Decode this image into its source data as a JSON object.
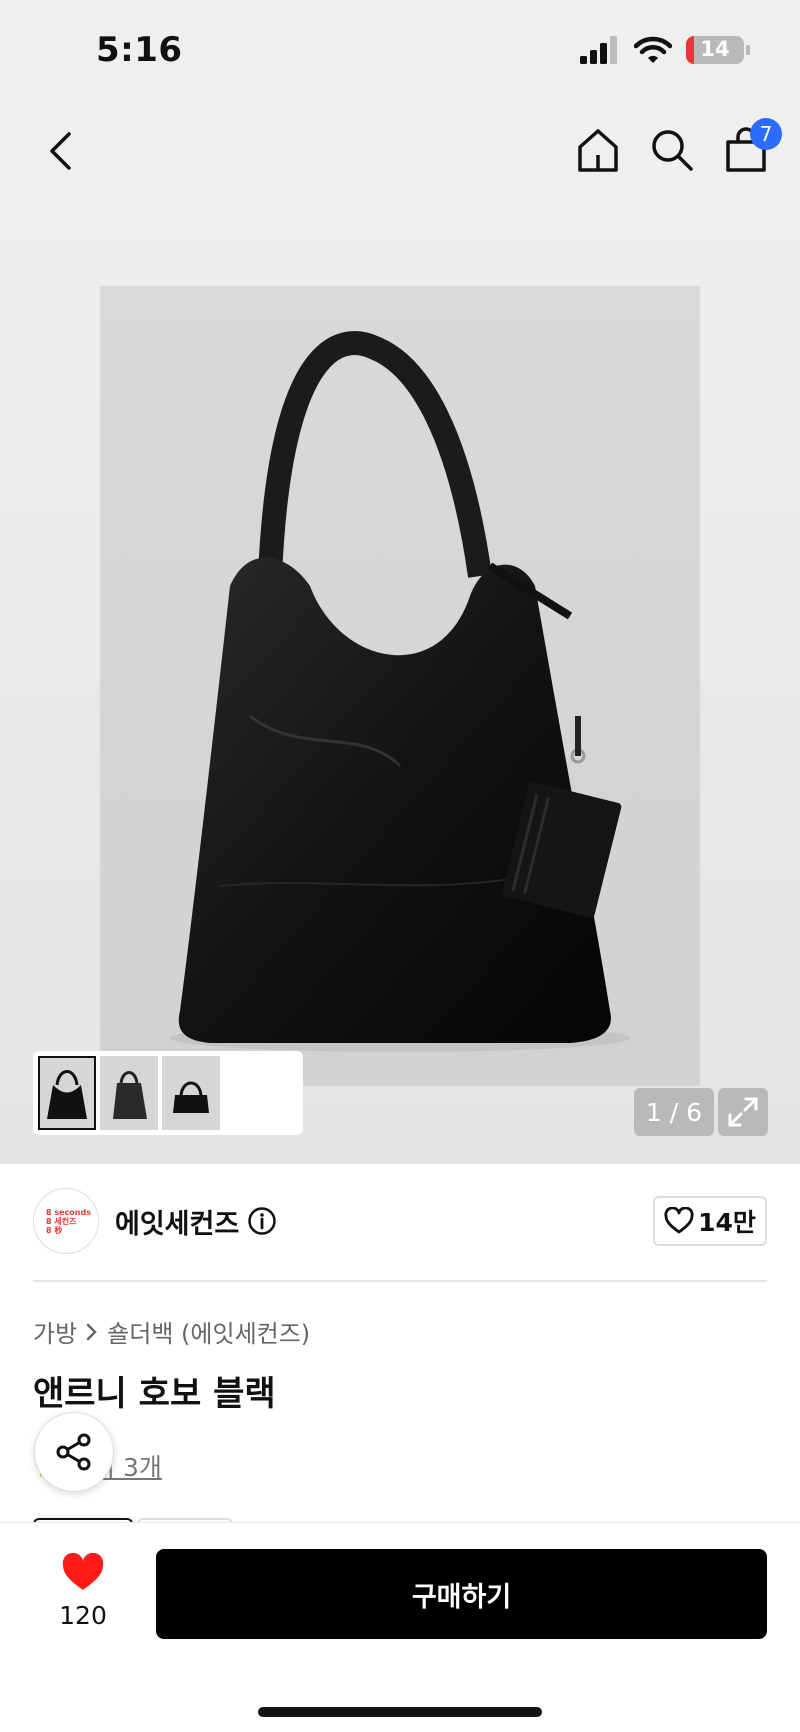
{
  "status_bar": {
    "time": "5:16",
    "battery_level": "14",
    "battery_color": "#e53935"
  },
  "nav": {
    "cart_count": "7",
    "badge_color": "#2b6bff"
  },
  "gallery": {
    "counter": "1 / 6",
    "current_image": 1,
    "total_images": 6,
    "thumbnail_count": 3
  },
  "brand": {
    "name": "에잇세컨즈",
    "logo_lines": [
      "8 seconds",
      "8 세컨즈",
      "8 秒"
    ],
    "likes": "14만",
    "logo_color": "#e53935"
  },
  "breadcrumb": {
    "category": "가방",
    "subcategory": "숄더백 (에잇세컨즈)"
  },
  "product": {
    "title": "앤르니 호보 블랙",
    "reviews_label": "후기 3개"
  },
  "bottom_bar": {
    "wish_count": "120",
    "buy_label": "구매하기",
    "wish_color": "#ff1a1a"
  }
}
